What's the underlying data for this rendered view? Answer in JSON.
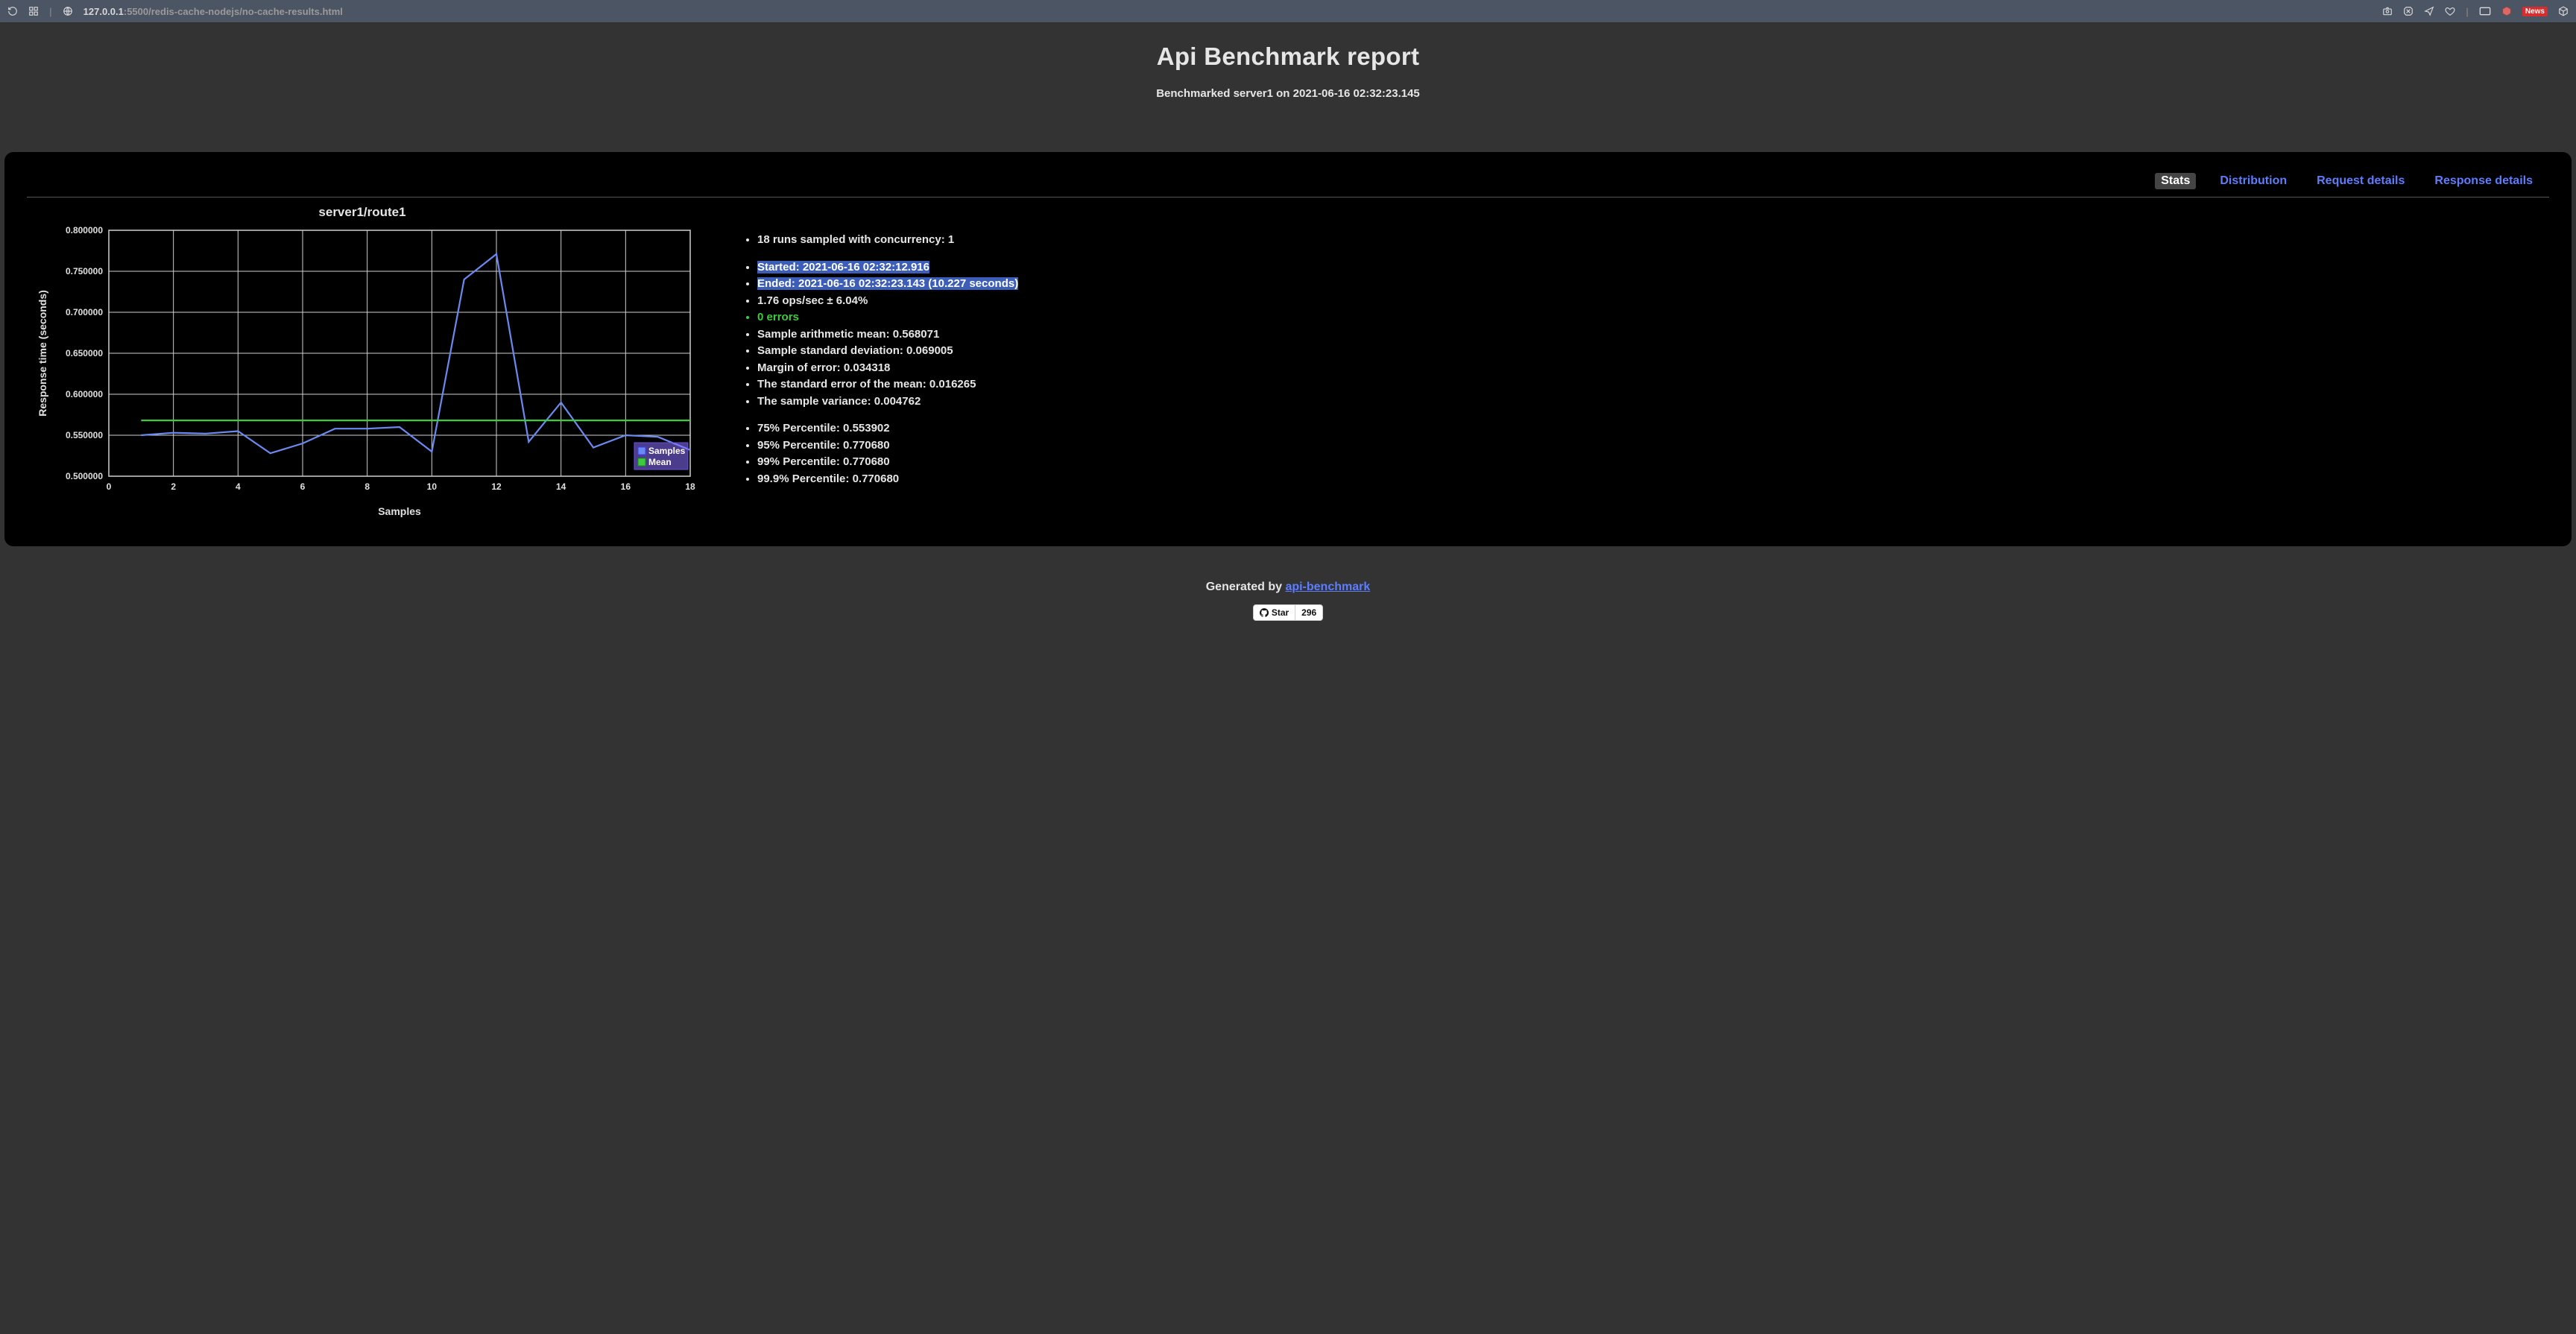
{
  "browser": {
    "url_host": "127.0.0.1",
    "url_port_path": ":5500/redis-cache-nodejs/no-cache-results.html",
    "news_label": "News"
  },
  "header": {
    "title": "Api Benchmark report",
    "subtitle": "Benchmarked server1 on 2021-06-16 02:32:23.145"
  },
  "tabs": {
    "stats": "Stats",
    "distribution": "Distribution",
    "request": "Request details",
    "response": "Response details"
  },
  "chart_title": "server1/route1",
  "stats": {
    "runs": "18 runs sampled with concurrency: 1",
    "started": "Started: 2021-06-16 02:32:12.916",
    "ended": "Ended: 2021-06-16 02:32:23.143 (10.227 seconds)",
    "ops": "1.76 ops/sec ± 6.04%",
    "errors": "0 errors",
    "mean": "Sample arithmetic mean: 0.568071",
    "std": "Sample standard deviation: 0.069005",
    "moe": "Margin of error: 0.034318",
    "sem": "The standard error of the mean: 0.016265",
    "var": "The sample variance: 0.004762",
    "p75": "75% Percentile: 0.553902",
    "p95": "95% Percentile: 0.770680",
    "p99": "99% Percentile: 0.770680",
    "p999": "99.9% Percentile: 0.770680"
  },
  "footer": {
    "generated_prefix": "Generated by ",
    "link_text": "api-benchmark",
    "star_label": "Star",
    "star_count": "296"
  },
  "legend": {
    "samples": "Samples",
    "mean": "Mean"
  },
  "chart_data": {
    "type": "line",
    "title": "server1/route1",
    "xlabel": "Samples",
    "ylabel": "Response time (seconds)",
    "xlim": [
      0,
      18
    ],
    "ylim": [
      0.5,
      0.8
    ],
    "x_ticks": [
      0,
      2,
      4,
      6,
      8,
      10,
      12,
      14,
      16,
      18
    ],
    "y_ticks": [
      0.5,
      0.55,
      0.6,
      0.65,
      0.7,
      0.75,
      0.8
    ],
    "y_tick_labels": [
      "0.500000",
      "0.550000",
      "0.600000",
      "0.650000",
      "0.700000",
      "0.750000",
      "0.800000"
    ],
    "series": [
      {
        "name": "Samples",
        "x": [
          1,
          2,
          3,
          4,
          5,
          6,
          7,
          8,
          9,
          10,
          11,
          12,
          13,
          14,
          15,
          16,
          17,
          18
        ],
        "y": [
          0.55,
          0.553,
          0.552,
          0.555,
          0.528,
          0.54,
          0.558,
          0.558,
          0.56,
          0.53,
          0.74,
          0.771,
          0.542,
          0.59,
          0.535,
          0.55,
          0.548,
          0.532
        ]
      },
      {
        "name": "Mean",
        "kind": "hline",
        "y": 0.568071
      }
    ]
  }
}
